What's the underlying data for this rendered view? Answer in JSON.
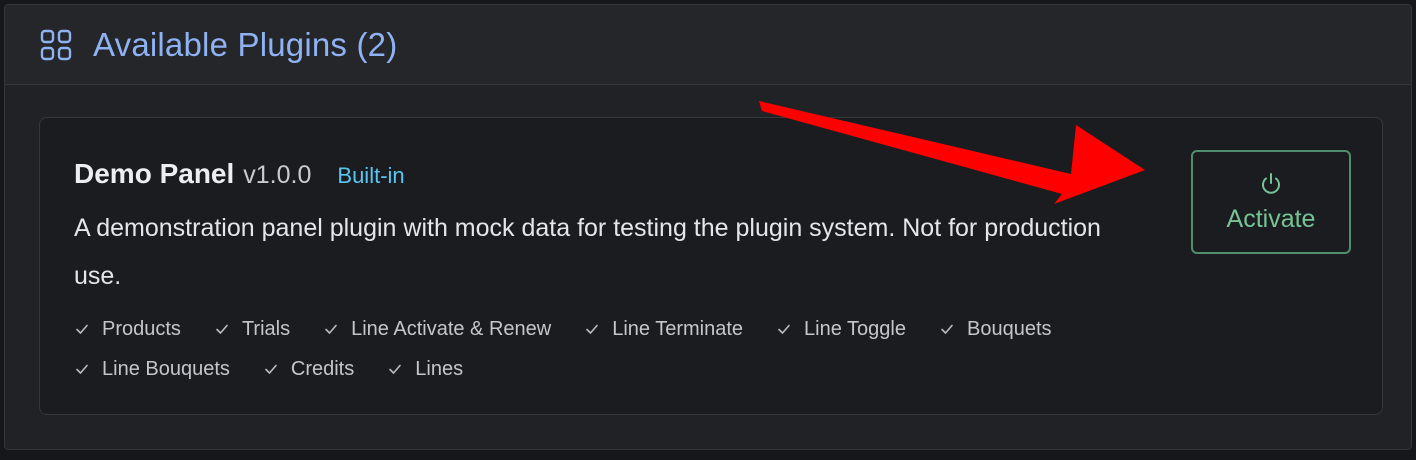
{
  "header": {
    "title": "Available Plugins (2)",
    "icon": "grid-icon"
  },
  "plugin": {
    "name": "Demo Panel",
    "version": "v1.0.0",
    "badge": "Built-in",
    "description": "A demonstration panel plugin with mock data for testing the plugin system. Not for production use.",
    "features": [
      [
        "Products",
        "Trials",
        "Line Activate & Renew",
        "Line Terminate",
        "Line Toggle",
        "Bouquets"
      ],
      [
        "Line Bouquets",
        "Credits",
        "Lines"
      ]
    ],
    "action": {
      "label": "Activate",
      "icon": "power-icon"
    }
  },
  "annotation": {
    "arrow_color": "#ff0000"
  },
  "colors": {
    "accent": "#8fb2f2",
    "badge": "#58c6f0",
    "activate": "#76c496"
  }
}
